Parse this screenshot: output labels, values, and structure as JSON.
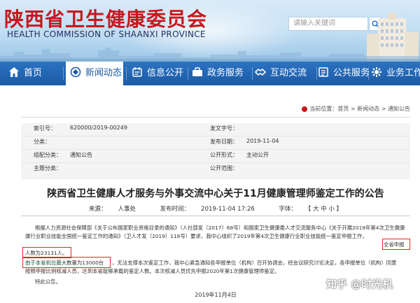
{
  "header": {
    "title": "陕西省卫生健康委员会",
    "subtitle": "HEALTH COMMISSION OF SHAANXI PROVINCE",
    "search_placeholder": "请输入关键词"
  },
  "nav": {
    "items": [
      {
        "label": "首页",
        "icon": "home-icon"
      },
      {
        "label": "新闻动态",
        "icon": "news-icon"
      },
      {
        "label": "信息公开",
        "icon": "info-icon"
      },
      {
        "label": "政务服务",
        "icon": "service-icon"
      },
      {
        "label": "互动交流",
        "icon": "chat-icon"
      },
      {
        "label": "公共服务",
        "icon": "public-icon"
      },
      {
        "label": "业务工作",
        "icon": "work-icon"
      }
    ],
    "active_index": 1
  },
  "breadcrumb": {
    "prefix": "当前位置：",
    "path": "首页 > 新闻动态 > 通知公告"
  },
  "meta": {
    "index_label": "索引号：",
    "index_value": "620000/2019-00249",
    "category_label": "分类：",
    "category_value": "",
    "org_label": "组配分类：",
    "org_value": "通知公告",
    "subject_label": "主题分类：",
    "subject_value": "",
    "doc_label": "发文字号：",
    "doc_value": "",
    "date_label": "发布日期：",
    "date_value": "2019-11-04",
    "form_label": "公开形式：",
    "form_value": "主动公开",
    "scope_label": "公开范围：",
    "scope_value": ""
  },
  "article": {
    "title": "陕西省卫生健康人才服务与外事交流中心关于11月健康管理师鉴定工作的公告",
    "source_label": "来源：",
    "source_value": "人事处",
    "publish_label": "发布时间：",
    "publish_value": "2019-11-04 17:26",
    "font_label": "字体：",
    "font_value": "【 大 中 小 】",
    "para1_a": "根据人力资源社会保障部《关于公布国家职业资格目录的通知》（人社部发〔2017〕68号）和国家卫生健康委人才交流服务中心《关于开展2019年第4次卫生健康",
    "para1_b": "康行业职业技能全国统一鉴定工作的通知》（卫人才发〔2019〕118号）要求，我中心组织了2019年第4次卫生健康行业职业技能统一鉴定申报工作，",
    "para1_hl1": "全省申报",
    "para1_hl2": "人数为23131人。",
    "para2_hl": "由于本省机位最大数量为13000台",
    "para2_a": "，无法支撑本次鉴定工作，我中心紧急通知各申报单位（机构）召开协调会，经会议研究讨论决定，各申报单位（机构）同意",
    "para2_b": "按照申报比例核减人员，达到本省能够承载的鉴定人数。本次核减人员优先申报2020年第1次健康管理师鉴定。",
    "para3": "特此公告。",
    "sign_date": "2019年11月4日"
  },
  "watermark": "知乎 @时光机",
  "colors": {
    "brand_red": "#c8161d",
    "nav_blue": "#1b5aa6",
    "highlight_red": "#e8232a"
  }
}
